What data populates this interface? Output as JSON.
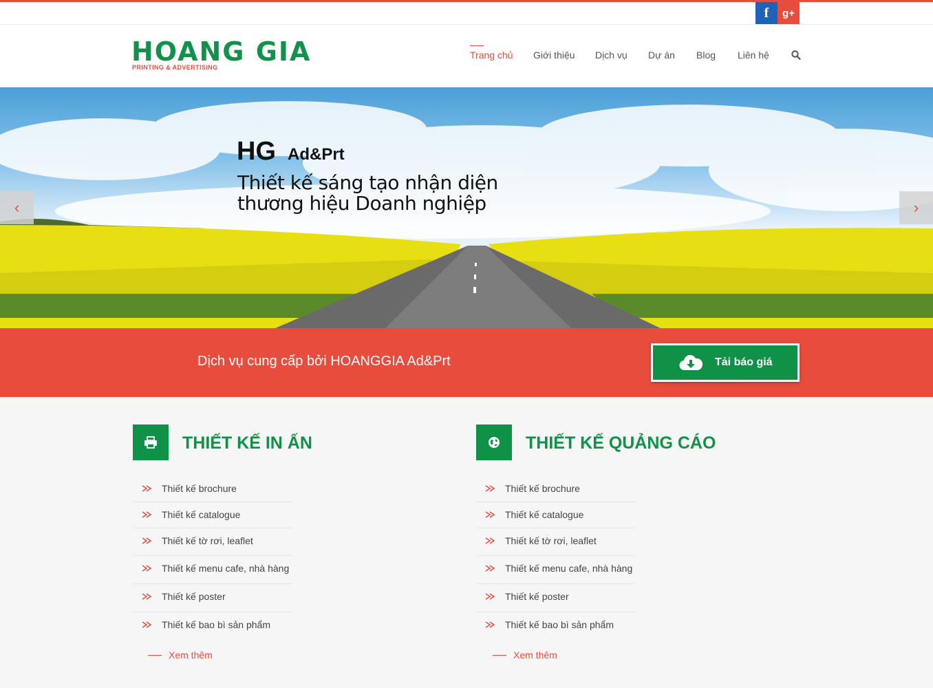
{
  "social": {
    "facebook_icon": "facebook-icon",
    "googleplus_icon": "google-plus-icon",
    "facebook_glyph": "f",
    "googleplus_glyph": "g+"
  },
  "logo": {
    "title": "HOANG GIA",
    "subtitle": "PRINTING & ADVERTISING"
  },
  "nav": {
    "items": [
      "Trang chủ",
      "Giới thiệu",
      "Dịch vụ",
      "Dự án",
      "Blog",
      "Liên hệ"
    ],
    "active_index": 0,
    "search_icon": "search-icon"
  },
  "hero": {
    "brand": "HG",
    "brand_suffix": "Ad&Prt",
    "line1": "Thiết kế sáng tạo nhận diện",
    "line2": "thương hiệu Doanh nghiệp",
    "prev_glyph": "‹",
    "next_glyph": "›"
  },
  "band": {
    "text": "Dịch vụ cung cấp bởi HOANGGIA Ad&Prt",
    "button_label": "Tải báo giá",
    "button_icon": "cloud-download-icon"
  },
  "services": [
    {
      "title": "THIẾT KẾ IN ẤN",
      "icon": "printer-icon",
      "items": [
        "Thiết kế brochure",
        "Thiết kế catalogue",
        "Thiết kế tờ rơi, leaflet",
        "Thiết kế menu cafe, nhà hàng",
        "Thiết kế poster",
        "Thiết kế bao bì sản phẩm"
      ],
      "more": "Xem thêm"
    },
    {
      "title": "THIẾT KẾ QUẢNG CÁO",
      "icon": "globe-icon",
      "items": [
        "Thiết kế brochure",
        "Thiết kế catalogue",
        "Thiết kế tờ rơi, leaflet",
        "Thiết kế menu cafe, nhà hàng",
        "Thiết kế poster",
        "Thiết kế bao bì sản phẩm"
      ],
      "more": "Xem thêm"
    }
  ],
  "colors": {
    "accent_red": "#e74c3c",
    "brand_green": "#0f9147"
  }
}
